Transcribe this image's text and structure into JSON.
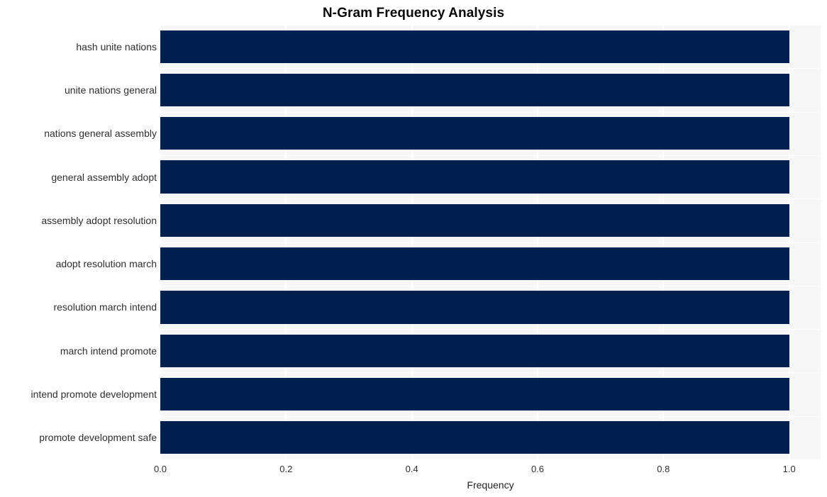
{
  "chart_data": {
    "type": "bar",
    "orientation": "horizontal",
    "title": "N-Gram Frequency Analysis",
    "xlabel": "Frequency",
    "ylabel": "",
    "categories": [
      "hash unite nations",
      "unite nations general",
      "nations general assembly",
      "general assembly adopt",
      "assembly adopt resolution",
      "adopt resolution march",
      "resolution march intend",
      "march intend promote",
      "intend promote development",
      "promote development safe"
    ],
    "values": [
      1.0,
      1.0,
      1.0,
      1.0,
      1.0,
      1.0,
      1.0,
      1.0,
      1.0,
      1.0
    ],
    "xlim": [
      0.0,
      1.05
    ],
    "xticks": [
      "0.0",
      "0.2",
      "0.4",
      "0.6",
      "0.8",
      "1.0"
    ],
    "xtick_values": [
      0.0,
      0.2,
      0.4,
      0.6,
      0.8,
      1.0
    ],
    "grid": true,
    "legend": null,
    "bar_color": "#002050",
    "plot_background": "#f7f7f7",
    "figure_background": "#ffffff",
    "gridline_color": "#fdfdfd"
  }
}
